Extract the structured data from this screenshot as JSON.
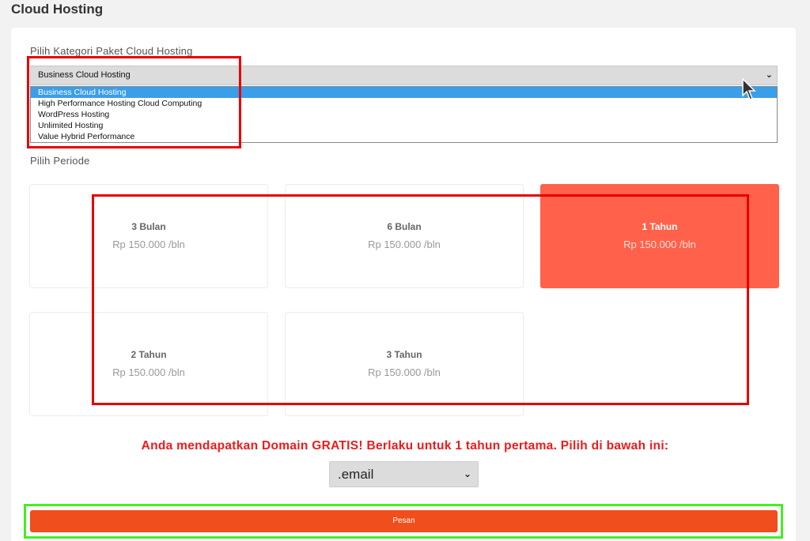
{
  "page": {
    "title": "Cloud Hosting"
  },
  "category": {
    "label": "Pilih Kategori Paket Cloud Hosting",
    "selected": "Business Cloud Hosting",
    "options": [
      "Business Cloud Hosting",
      "High Performance Hosting Cloud Computing",
      "WordPress Hosting",
      "Unlimited Hosting",
      "Value Hybrid Performance"
    ]
  },
  "period": {
    "label": "Pilih Periode",
    "items": [
      {
        "name": "3 Bulan",
        "price": "Rp 150.000 /bln",
        "active": false
      },
      {
        "name": "6 Bulan",
        "price": "Rp 150.000 /bln",
        "active": false
      },
      {
        "name": "1 Tahun",
        "price": "Rp 150.000 /bln",
        "active": true
      },
      {
        "name": "2 Tahun",
        "price": "Rp 150.000 /bln",
        "active": false
      },
      {
        "name": "3 Tahun",
        "price": "Rp 150.000 /bln",
        "active": false
      }
    ]
  },
  "promo": {
    "text": "Anda mendapatkan Domain GRATIS! Berlaku untuk 1 tahun pertama. Pilih di bawah ini:"
  },
  "domain": {
    "selected": ".email"
  },
  "order": {
    "label": "Pesan"
  },
  "icons": {
    "dropdown_chevron": "chevron-down-icon",
    "cursor": "mouse-pointer-icon"
  },
  "colors": {
    "accent": "#ff614a",
    "order_button": "#f04e1c",
    "promo": "#ee1a1a",
    "option_highlight": "#3b9ee8",
    "annotation_red": "#e60000",
    "annotation_green": "#44ee22"
  }
}
